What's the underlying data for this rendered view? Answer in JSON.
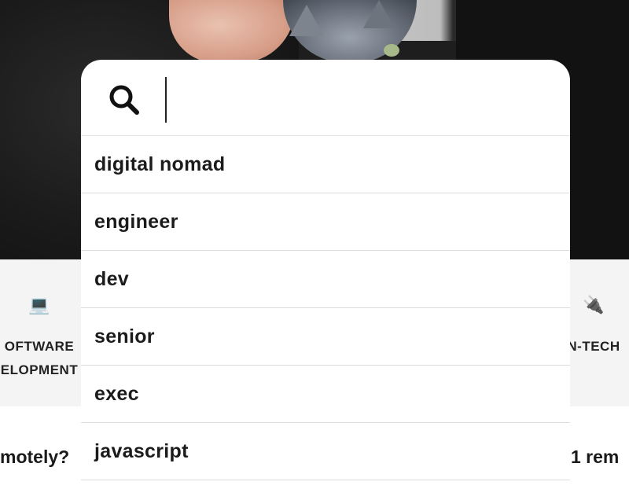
{
  "search": {
    "value": "",
    "placeholder": ""
  },
  "suggestions": [
    "digital nomad",
    "engineer",
    "dev",
    "senior",
    "exec",
    "javascript"
  ],
  "categories": {
    "software": {
      "emoji": "💻",
      "line1": "OFTWARE",
      "line2": "ELOPMENT"
    },
    "nontech": {
      "emoji": "🔌",
      "line1": "N-TECH"
    }
  },
  "questions": {
    "left": "motely?",
    "right": "1 rem"
  },
  "icons": {
    "search": "search-icon"
  },
  "colors": {
    "card": "#ffffff",
    "text": "#1b1b1b",
    "divider": "#dcdcdc",
    "strip": "#f4f4f4"
  }
}
